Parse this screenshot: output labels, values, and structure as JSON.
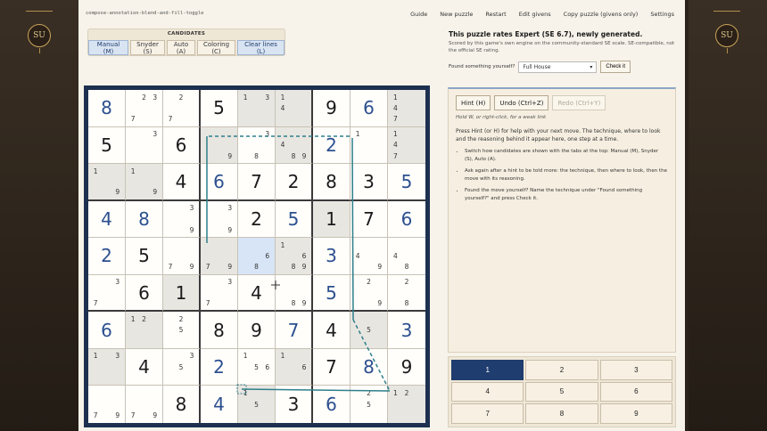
{
  "file_label": "compose-annotation-blend-and-fill-toggle",
  "badge_left": "SU",
  "badge_right": "SU",
  "nav": [
    "Guide",
    "New puzzle",
    "Restart",
    "Edit givens",
    "Copy puzzle (givens only)",
    "Settings"
  ],
  "candidates": {
    "title": "CANDIDATES",
    "buttons": [
      "Manual (M)",
      "Snyder (S)",
      "Auto (A)",
      "Coloring (C)",
      "Clear lines (L)"
    ],
    "active": "Manual (M)"
  },
  "rating": {
    "headline": "This puzzle rates Expert (SE 6.7), newly generated.",
    "note": "Scored by this game's own engine on the community-standard SE scale. SE-compatible, not the official SE rating."
  },
  "found": {
    "label": "Found something yourself?",
    "selected": "Full House",
    "check": "Check it"
  },
  "hint": {
    "hint_button": "Hint (H)",
    "undo_button": "Undo (Ctrl+Z)",
    "redo_button": "Redo (Ctrl+Y)",
    "hold": "Hold W, or right-click, for a weak link",
    "press": "Press Hint (or H) for help with your next move. The technique, where to look and the reasoning behind it appear here, one step at a time.",
    "tips": [
      "Switch how candidates are shown with the tabs at the top: Manual (M), Snyder (S), Auto (A).",
      "Ask again after a hint to be told more: the technique, then where to look, then the move with its reasoning.",
      "Found the move yourself? Name the technique under \"Found something yourself?\" and press Check it."
    ]
  },
  "numpad": [
    "1",
    "2",
    "3",
    "4",
    "5",
    "6",
    "7",
    "8",
    "9"
  ],
  "numpad_active": "1",
  "grid": [
    [
      {
        "v": "8",
        "t": "u"
      },
      {
        "c": [
          2,
          3,
          7
        ]
      },
      {
        "c": [
          2,
          7
        ]
      },
      {
        "v": "5",
        "t": "g"
      },
      {
        "c": [
          1,
          3
        ],
        "s": 1
      },
      {
        "c": [
          1,
          4
        ],
        "s": 1
      },
      {
        "v": "9",
        "t": "g"
      },
      {
        "v": "6",
        "t": "u"
      },
      {
        "c": [
          1,
          4,
          7
        ],
        "s": 1
      }
    ],
    [
      {
        "v": "5",
        "t": "g"
      },
      {
        "c": [
          3
        ]
      },
      {
        "v": "6",
        "t": "g"
      },
      {
        "c": [
          9
        ],
        "s": 1
      },
      {
        "c": [
          3,
          8
        ]
      },
      {
        "c": [
          4,
          8,
          9
        ],
        "s": 1
      },
      {
        "v": "2",
        "t": "u"
      },
      {
        "c": [
          1
        ]
      },
      {
        "c": [
          1,
          4,
          7
        ],
        "s": 1
      }
    ],
    [
      {
        "c": [
          1,
          9
        ],
        "s": 1
      },
      {
        "c": [
          1,
          9
        ],
        "s": 1
      },
      {
        "v": "4",
        "t": "g"
      },
      {
        "v": "6",
        "t": "u"
      },
      {
        "v": "7",
        "t": "g"
      },
      {
        "v": "2",
        "t": "g"
      },
      {
        "v": "8",
        "t": "g"
      },
      {
        "v": "3",
        "t": "g"
      },
      {
        "v": "5",
        "t": "u"
      }
    ],
    [
      {
        "v": "4",
        "t": "u"
      },
      {
        "v": "8",
        "t": "u"
      },
      {
        "c": [
          3,
          9
        ]
      },
      {
        "c": [
          3,
          9
        ]
      },
      {
        "v": "2",
        "t": "g"
      },
      {
        "v": "5",
        "t": "u"
      },
      {
        "v": "1",
        "t": "g",
        "s": 1
      },
      {
        "v": "7",
        "t": "g"
      },
      {
        "v": "6",
        "t": "u"
      }
    ],
    [
      {
        "v": "2",
        "t": "u"
      },
      {
        "v": "5",
        "t": "g"
      },
      {
        "c": [
          7,
          9
        ]
      },
      {
        "c": [
          7,
          9
        ],
        "s": 1
      },
      {
        "c": [
          6,
          8
        ],
        "sel": 1
      },
      {
        "c": [
          1,
          6,
          8,
          9
        ],
        "s": 1
      },
      {
        "v": "3",
        "t": "u"
      },
      {
        "c": [
          4,
          9
        ]
      },
      {
        "c": [
          4,
          8
        ]
      }
    ],
    [
      {
        "c": [
          3,
          7
        ]
      },
      {
        "v": "6",
        "t": "g"
      },
      {
        "v": "1",
        "t": "g",
        "s": 1
      },
      {
        "c": [
          3,
          7
        ]
      },
      {
        "v": "4",
        "t": "g"
      },
      {
        "c": [
          8,
          9
        ]
      },
      {
        "v": "5",
        "t": "u"
      },
      {
        "c": [
          2,
          9
        ]
      },
      {
        "c": [
          2,
          8
        ]
      }
    ],
    [
      {
        "v": "6",
        "t": "u"
      },
      {
        "c": [
          1,
          2
        ],
        "s": 1
      },
      {
        "c": [
          2,
          5
        ]
      },
      {
        "v": "8",
        "t": "g"
      },
      {
        "v": "9",
        "t": "g"
      },
      {
        "v": "7",
        "t": "u"
      },
      {
        "v": "4",
        "t": "g"
      },
      {
        "c": [
          5
        ],
        "s": 1
      },
      {
        "v": "3",
        "t": "u"
      }
    ],
    [
      {
        "c": [
          1,
          3
        ],
        "s": 1
      },
      {
        "v": "4",
        "t": "g"
      },
      {
        "c": [
          3,
          5
        ]
      },
      {
        "v": "2",
        "t": "u"
      },
      {
        "c": [
          1,
          5,
          6
        ]
      },
      {
        "c": [
          1,
          6
        ],
        "s": 1
      },
      {
        "v": "7",
        "t": "g"
      },
      {
        "v": "8",
        "t": "u"
      },
      {
        "v": "9",
        "t": "g"
      }
    ],
    [
      {
        "c": [
          7,
          9
        ]
      },
      {
        "c": [
          7,
          9
        ]
      },
      {
        "v": "8",
        "t": "g"
      },
      {
        "v": "4",
        "t": "u"
      },
      {
        "c": [
          1,
          5
        ],
        "s": 1
      },
      {
        "v": "3",
        "t": "g"
      },
      {
        "v": "6",
        "t": "u"
      },
      {
        "c": [
          2,
          5
        ]
      },
      {
        "c": [
          1,
          2
        ],
        "s": 1
      }
    ]
  ]
}
